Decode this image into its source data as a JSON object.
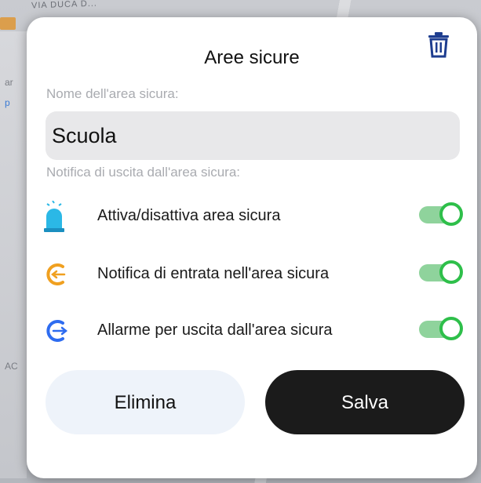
{
  "map": {
    "street_label": "VIA DUCA D...",
    "side_letters": [
      "ar",
      "p",
      "AC"
    ]
  },
  "dialog": {
    "title": "Aree sicure",
    "name_label": "Nome dell'area sicura:",
    "name_value": "Scuola",
    "notify_label": "Notifica di uscita dall'area sicura:",
    "options": [
      {
        "icon": "alarm-light-icon",
        "label": "Attiva/disattiva area sicura",
        "enabled": true
      },
      {
        "icon": "enter-arrow-icon",
        "label": "Notifica di entrata nell'area sicura",
        "enabled": true
      },
      {
        "icon": "exit-arrow-icon",
        "label": "Allarme per uscita dall'area sicura",
        "enabled": true
      }
    ],
    "delete_label": "Elimina",
    "save_label": "Salva"
  },
  "colors": {
    "toggle_on": "#2ebf4a",
    "toggle_track": "#8fd39c",
    "alarm_icon": "#2bb8e6",
    "enter_icon": "#f0a020",
    "exit_icon": "#2e6cf0",
    "trash_icon": "#1e3d8f",
    "save_button": "#1b1b1b",
    "delete_button": "#eef3fa"
  }
}
